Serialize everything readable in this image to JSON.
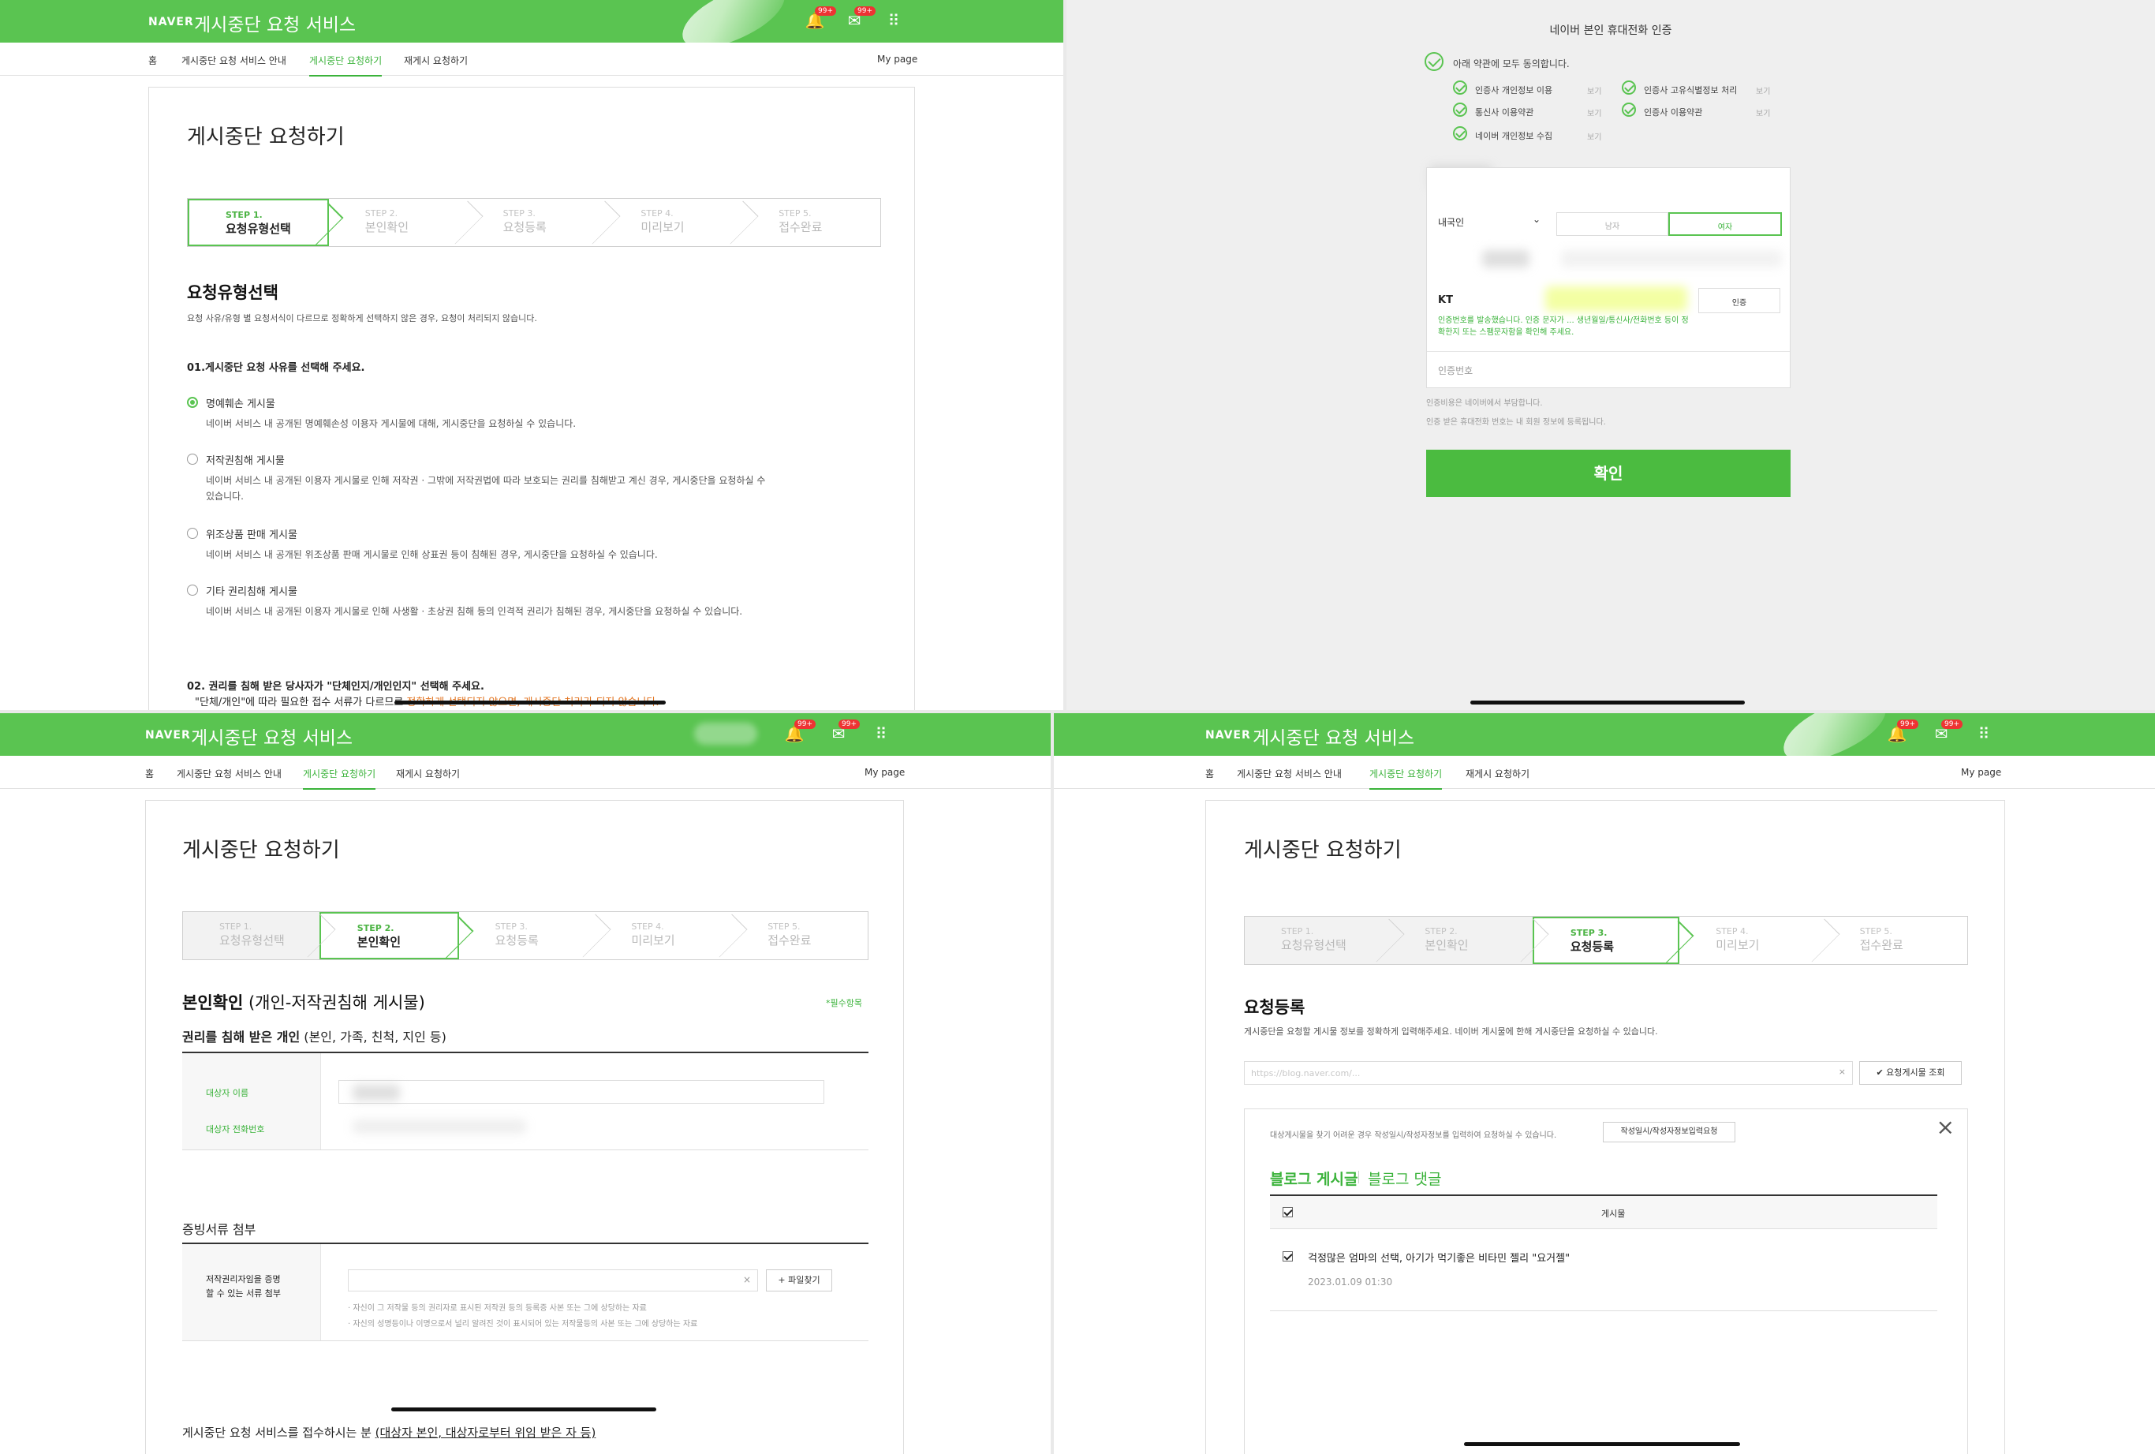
{
  "common": {
    "brand": "NAVER",
    "service_title": "게시중단 요청 서비스",
    "badge": "99+",
    "nav": [
      "홈",
      "게시중단 요청 서비스 안내",
      "게시중단 요청하기",
      "재게시 요청하기"
    ],
    "mypage": "My page",
    "page_title": "게시중단 요청하기",
    "steps": [
      {
        "num": "STEP 1.",
        "label": "요청유형선택"
      },
      {
        "num": "STEP 2.",
        "label": "본인확인"
      },
      {
        "num": "STEP 3.",
        "label": "요청등록"
      },
      {
        "num": "STEP 4.",
        "label": "미리보기"
      },
      {
        "num": "STEP 5.",
        "label": "접수완료"
      }
    ]
  },
  "p1": {
    "section_title": "요청유형선택",
    "section_desc": "요청 사유/유형 별 요청서식이 다르므로 정확하게 선택하지 않은 경우, 요청이 처리되지 않습니다.",
    "q1": "01.게시중단 요청 사유를 선택해 주세요.",
    "options": [
      {
        "label": "명예훼손 게시물",
        "desc": "네이버 서비스 내 공개된 명예훼손성 이용자 게시물에 대해, 게시중단을 요청하실 수 있습니다."
      },
      {
        "label": "저작권침해 게시물",
        "desc": "네이버 서비스 내 공개된 이용자 게시물로 인해 저작권 · 그밖에 저작권법에 따라 보호되는 권리를 침해받고 계신 경우, 게시중단을 요청하실 수 있습니다."
      },
      {
        "label": "위조상품 판매 게시물",
        "desc": "네이버 서비스 내 공개된 위조상품 판매 게시물로 인해 상표권 등이 침해된 경우, 게시중단을 요청하실 수 있습니다."
      },
      {
        "label": "기타 권리침해 게시물",
        "desc": "네이버 서비스 내 공개된 이용자 게시물로 인해 사생활 · 초상권 침해 등의 인격적 권리가 침해된 경우, 게시중단을 요청하실 수 있습니다."
      }
    ],
    "q2": "02. 권리를 침해 받은 당사자가 \"단체인지/개인인지\" 선택해 주세요.",
    "q2_sub_a": "\"단체/개인\"에 따라 필요한 접수 서류가 다르므로 ",
    "q2_sub_b": "정확하게 선택되지 않으면, 게시중단 처리가 되지 않습니다."
  },
  "p2": {
    "title": "네이버 본인 휴대전화 인증",
    "agree_all": "아래 약관에 모두 동의합니다.",
    "terms_left": [
      "인증사 개인정보 이용",
      "통신사 이용약관",
      "네이버 개인정보 수집"
    ],
    "terms_right": [
      "인증사 고유식별정보 처리",
      "인증사 이용약관"
    ],
    "view": "보기",
    "nationality": "내국인",
    "gender_m": "남자",
    "gender_f": "여자",
    "carrier": "KT",
    "auth_btn": "인증",
    "green_hint_1": "인증번호를 발송했습니다. 인증 문자가 ... 생년월일/통신사/전화번호 등이 정",
    "green_hint_2": "확한지 또는 스팸문자함을 확인해 주세요.",
    "code_placeholder": "인증번호",
    "hint1": "인증비용은 네이버에서 부담합니다.",
    "hint2": "인증 받은 휴대전화 번호는 내 회원 정보에 등록됩니다.",
    "confirm": "확인"
  },
  "p3": {
    "section_title_bold": "본인확인",
    "section_title_rest": " (개인-저작권침해 게시물)",
    "required": "*필수항목",
    "sub_bold": "권리를 침해 받은 개인",
    "sub_rest": " (본인, 가족, 친척, 지인 등)",
    "label_name": "대상자 이름",
    "label_phone": "대상자 전화번호",
    "attach_title": "증빙서류 첨부",
    "attach_label_1": "저작권리자임을 증명",
    "attach_label_2": "할 수 있는 서류 첨부",
    "file_btn": "+ 파일찾기",
    "note1": "· 자신이 그 저작물 등의 권리자로 표시된 저작권 등의 등록증 사본 또는 그에 상당하는 자료",
    "note2": "· 자신의 성명등이나 이명으로서 널리 알려진 것이 표시되어 있는 저작물등의 사본 또는 그에 상당하는 자료",
    "bottom_a": "게시중단 요청 서비스를 접수하시는 분 ",
    "bottom_b": "(대상자 본인, 대상자로부터 위임 받은 자 등)"
  },
  "p4": {
    "section_title": "요청등록",
    "section_desc": "게시중단을 요청할 게시물 정보를 정확하게 입력해주세요. 네이버 게시물에 한해 게시중단을 요청하실 수 있습니다.",
    "url_value": "https://blog.naver.com/...",
    "lookup_btn": "✔ 요청게시물 조회",
    "box_desc": "대상게시물을 찾기 어려운 경우 작성일시/작성자정보를 입력하여 요청하실 수 있습니다.",
    "box_btn": "작성일시/작성자정보입력요청",
    "tab_post": "블로그 게시글",
    "tab_comment": "블로그 댓글",
    "col_header": "게시물",
    "row_title": "걱정많은 엄마의 선택, 아기가 먹기좋은 비타민 젤리 \"요거젤\"",
    "row_date": "2023.01.09 01:30"
  }
}
